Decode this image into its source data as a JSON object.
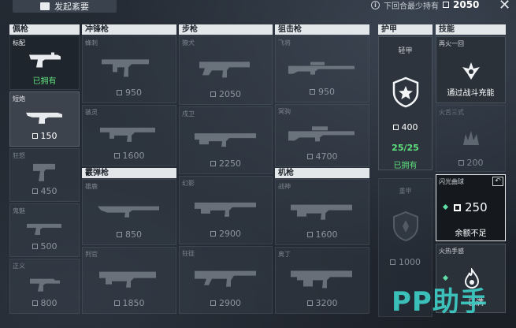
{
  "topbar": {
    "left_button": "发起紊要",
    "info_icon": "info-icon",
    "info_label": "下回合最少持有",
    "currency_amount": "2050",
    "close_icon": "close-icon"
  },
  "columns": {
    "pistol": "佩枪",
    "smg": "冲锋枪",
    "rifle": "步枪",
    "sniper": "狙击枪",
    "armor": "护甲",
    "skill": "技能",
    "shotgun": "霰弹枪",
    "mg": "机枪"
  },
  "pistols": [
    {
      "name": "标配",
      "status": "已拥有"
    },
    {
      "name": "短炮",
      "price": "150"
    },
    {
      "name": "狂怒",
      "price": "450"
    },
    {
      "name": "鬼魅",
      "price": "500"
    },
    {
      "name": "正义",
      "price": "800"
    }
  ],
  "smgs": [
    {
      "name": "蜂刺",
      "price": "950"
    },
    {
      "name": "骇灵",
      "price": "1600"
    }
  ],
  "shotguns": [
    {
      "name": "雄鹿",
      "price": "850"
    },
    {
      "name": "判官",
      "price": "1850"
    }
  ],
  "rifles": [
    {
      "name": "獠犬",
      "price": "2050"
    },
    {
      "name": "戍卫",
      "price": "2250"
    },
    {
      "name": "幻影",
      "price": "2900"
    },
    {
      "name": "狂徒",
      "price": "2900"
    }
  ],
  "snipers": [
    {
      "name": "飞将",
      "price": "950"
    },
    {
      "name": "冥驹",
      "price": "4700"
    }
  ],
  "mgs": [
    {
      "name": "战神",
      "price": "1600"
    },
    {
      "name": "奥丁",
      "price": "3200"
    }
  ],
  "armor": {
    "light": {
      "name": "轻甲",
      "price": "400",
      "durability": "25/25",
      "status": "已拥有"
    },
    "heavy": {
      "name": "重甲",
      "price": "1000"
    }
  },
  "skills": [
    {
      "name": "再火一回",
      "desc": "通过战斗充能"
    },
    {
      "name": "火舌三式",
      "price": "200"
    },
    {
      "name": "闪光曲球",
      "price": "250",
      "desc": "余额不足"
    },
    {
      "name": "火热手感",
      "status": "已满"
    }
  ],
  "watermark": "PP助手"
}
